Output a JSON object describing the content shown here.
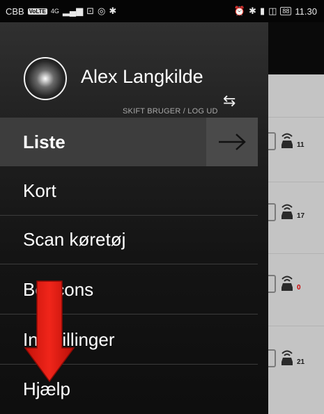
{
  "statusbar": {
    "carrier": "CBB",
    "volte": "VoLTE",
    "network": "4G",
    "battery": "88",
    "time": "11.30"
  },
  "drawer": {
    "user_name": "Alex Langkilde",
    "switch_user": "SKIFT BRUGER / LOG UD",
    "items": [
      {
        "label": "Liste",
        "active": true
      },
      {
        "label": "Kort"
      },
      {
        "label": "Scan køretøj"
      },
      {
        "label": "Beacons"
      },
      {
        "label": "Indstillinger"
      },
      {
        "label": "Hjælp"
      }
    ]
  },
  "background_list": {
    "counts": [
      "11",
      "17",
      "0",
      "21"
    ]
  },
  "icons": {
    "switch": "swap-arrows-icon",
    "forward": "arrow-right-icon",
    "car": "connected-car-icon",
    "overlay": "red-down-arrow"
  },
  "colors": {
    "overlay_arrow": "#e81c12",
    "zero_count": "#cc0000"
  }
}
